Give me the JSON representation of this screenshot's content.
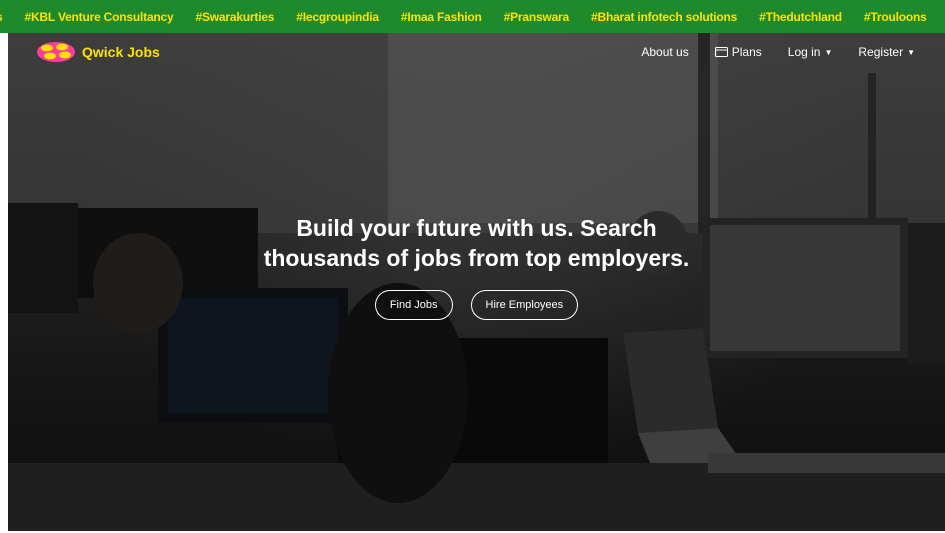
{
  "ticker": {
    "items": [
      "s",
      "#KBL Venture Consultancy",
      "#Swarakurties",
      "#Iecgroupindia",
      "#Imaa Fashion",
      "#Pranswara",
      "#Bharat infotech solutions",
      "#Thedutchland",
      "#Trouloons"
    ],
    "background": "#1f8a2c",
    "text_color": "#ffe100"
  },
  "navbar": {
    "brand": "Qwick Jobs",
    "brand_color": "#ffe100",
    "about": "About us",
    "plans": "Plans",
    "login": "Log in",
    "register": "Register"
  },
  "hero": {
    "headline_line1": "Build your future with us. Search",
    "headline_line2": "thousands of jobs from top employers.",
    "find_jobs": "Find Jobs",
    "hire_employees": "Hire Employees"
  }
}
